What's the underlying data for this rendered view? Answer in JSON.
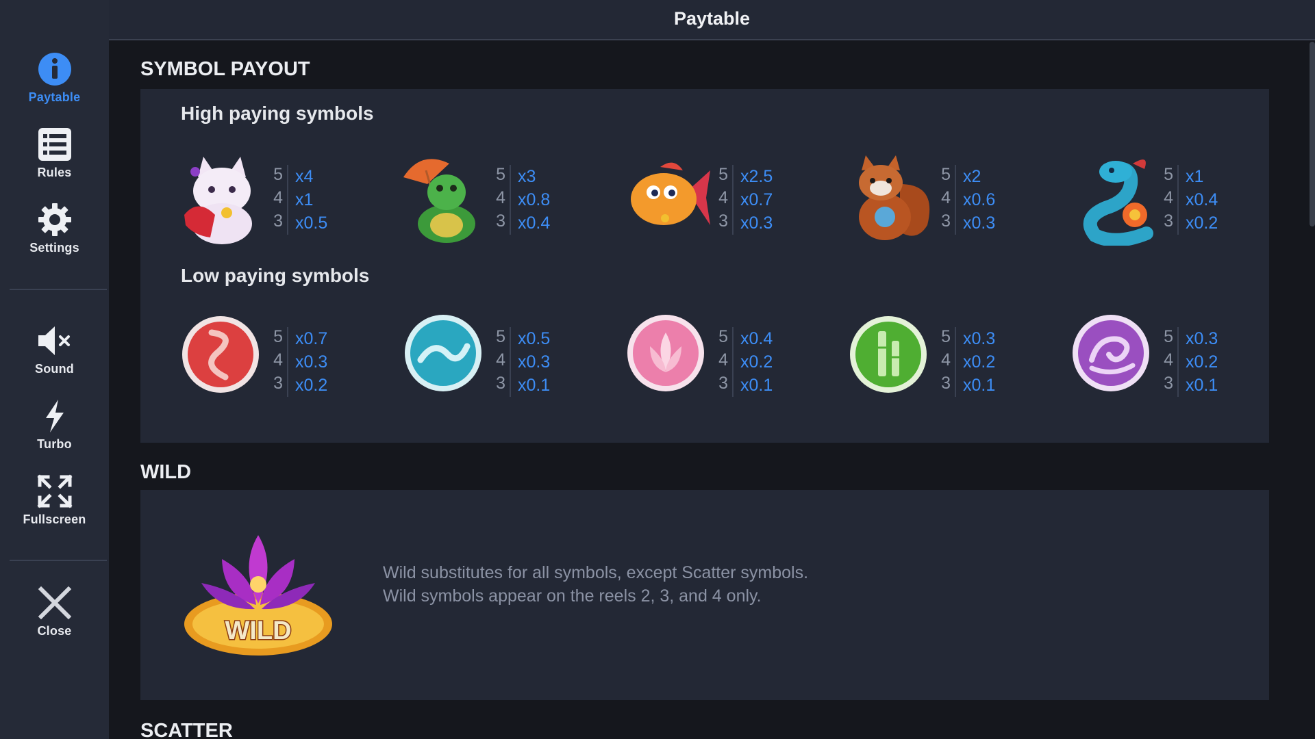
{
  "topbar": {
    "title": "Paytable"
  },
  "sidebar": {
    "items": [
      {
        "label": "Paytable",
        "icon": "info-icon",
        "active": true
      },
      {
        "label": "Rules",
        "icon": "list-icon"
      },
      {
        "label": "Settings",
        "icon": "gear-icon"
      },
      {
        "label": "Sound",
        "icon": "speaker-muted-icon"
      },
      {
        "label": "Turbo",
        "icon": "lightning-icon"
      },
      {
        "label": "Fullscreen",
        "icon": "fullscreen-icon"
      },
      {
        "label": "Close",
        "icon": "close-icon"
      }
    ]
  },
  "colors": {
    "accent": "#3d8df5",
    "panel": "#232835",
    "background": "#15171d",
    "sidebar": "#252a37"
  },
  "symbol_payout": {
    "heading": "SYMBOL PAYOUT",
    "high": {
      "heading": "High paying symbols",
      "symbols": [
        {
          "icon": "lucky-cat-icon",
          "pays": [
            {
              "count": "5",
              "value": "x4"
            },
            {
              "count": "4",
              "value": "x1"
            },
            {
              "count": "3",
              "value": "x0.5"
            }
          ]
        },
        {
          "icon": "turtle-umbrella-icon",
          "pays": [
            {
              "count": "5",
              "value": "x3"
            },
            {
              "count": "4",
              "value": "x0.8"
            },
            {
              "count": "3",
              "value": "x0.4"
            }
          ]
        },
        {
          "icon": "goldfish-icon",
          "pays": [
            {
              "count": "5",
              "value": "x2.5"
            },
            {
              "count": "4",
              "value": "x0.7"
            },
            {
              "count": "3",
              "value": "x0.3"
            }
          ]
        },
        {
          "icon": "red-panda-icon",
          "pays": [
            {
              "count": "5",
              "value": "x2"
            },
            {
              "count": "4",
              "value": "x0.6"
            },
            {
              "count": "3",
              "value": "x0.3"
            }
          ]
        },
        {
          "icon": "snake-icon",
          "pays": [
            {
              "count": "5",
              "value": "x1"
            },
            {
              "count": "4",
              "value": "x0.4"
            },
            {
              "count": "3",
              "value": "x0.2"
            }
          ]
        }
      ]
    },
    "low": {
      "heading": "Low paying symbols",
      "symbols": [
        {
          "icon": "red-fire-coin-icon",
          "pays": [
            {
              "count": "5",
              "value": "x0.7"
            },
            {
              "count": "4",
              "value": "x0.3"
            },
            {
              "count": "3",
              "value": "x0.2"
            }
          ]
        },
        {
          "icon": "blue-wave-coin-icon",
          "pays": [
            {
              "count": "5",
              "value": "x0.5"
            },
            {
              "count": "4",
              "value": "x0.3"
            },
            {
              "count": "3",
              "value": "x0.1"
            }
          ]
        },
        {
          "icon": "pink-lotus-coin-icon",
          "pays": [
            {
              "count": "5",
              "value": "x0.4"
            },
            {
              "count": "4",
              "value": "x0.2"
            },
            {
              "count": "3",
              "value": "x0.1"
            }
          ]
        },
        {
          "icon": "green-bamboo-coin-icon",
          "pays": [
            {
              "count": "5",
              "value": "x0.3"
            },
            {
              "count": "4",
              "value": "x0.2"
            },
            {
              "count": "3",
              "value": "x0.1"
            }
          ]
        },
        {
          "icon": "purple-wave-coin-icon",
          "pays": [
            {
              "count": "5",
              "value": "x0.3"
            },
            {
              "count": "4",
              "value": "x0.2"
            },
            {
              "count": "3",
              "value": "x0.1"
            }
          ]
        }
      ]
    }
  },
  "wild": {
    "heading": "WILD",
    "icon": "wild-lotus-icon",
    "badge": "WILD",
    "lines": [
      "Wild substitutes for all symbols, except Scatter symbols.",
      "Wild symbols appear on the reels 2, 3, and 4 only."
    ]
  },
  "scatter": {
    "heading": "SCATTER"
  }
}
